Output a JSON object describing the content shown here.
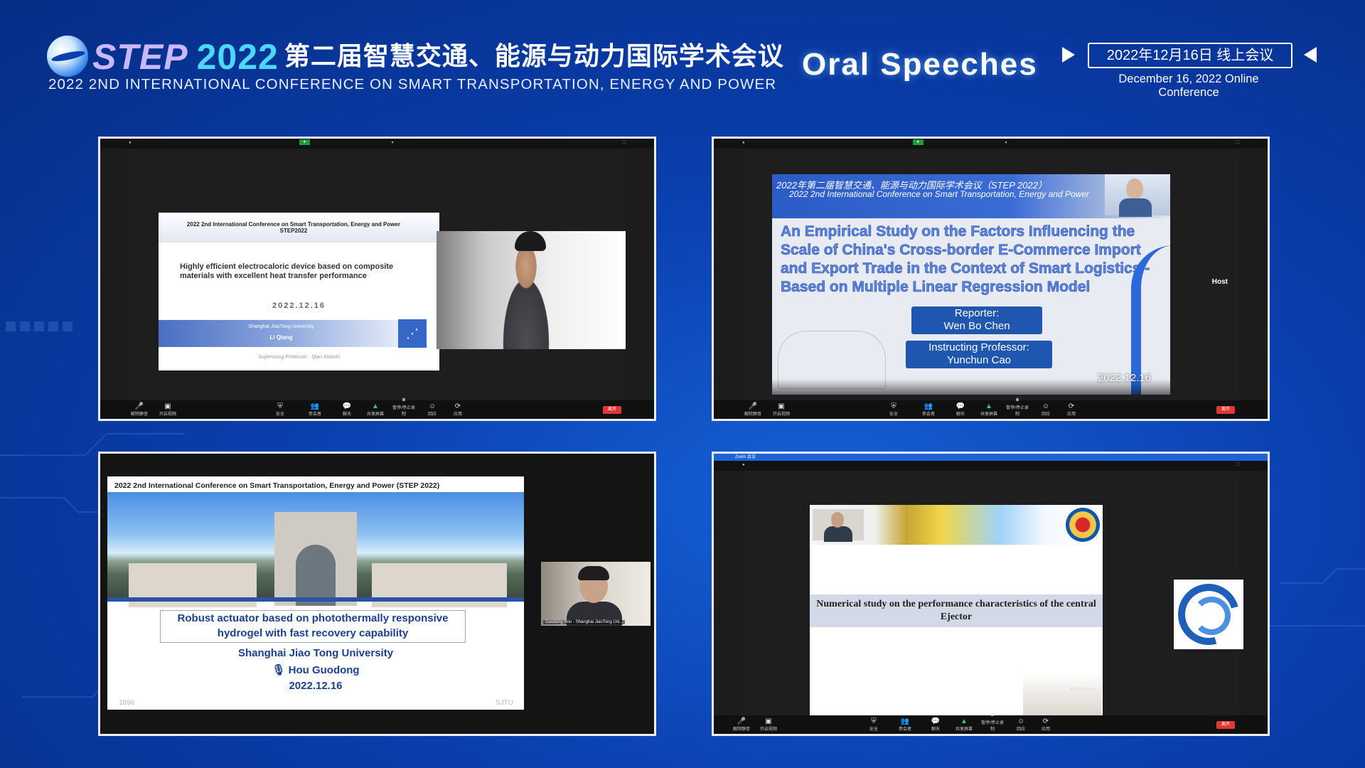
{
  "header": {
    "brand_step": "STEP",
    "brand_year": "2022",
    "conf_cn": "第二届智慧交通、能源与动力国际学术会议",
    "conf_en": "2022 2ND INTERNATIONAL CONFERENCE ON SMART TRANSPORTATION, ENERGY AND POWER",
    "section": "Oral Speeches",
    "date_cn": "2022年12月16日  线上会议",
    "date_en": "December 16, 2022  Online Conference"
  },
  "colors": {
    "background": "#0a3fae",
    "accent": "#4ad8ff",
    "record_green": "#1d9b3a",
    "end_red": "#e23636"
  },
  "toolbar": {
    "items": [
      "解除静音",
      "开启视频",
      "安全",
      "参会者",
      "聊天",
      "共享屏幕",
      "暂停/停止录制",
      "回应",
      "应用"
    ],
    "end": "离开"
  },
  "windows": [
    {
      "slide": {
        "header": "2022 2nd International Conference on Smart Transportation, Energy and Power STEP2022",
        "title": "Highly efficient electrocaloric device based on composite materials with excellent heat transfer performance",
        "date": "2022.12.16",
        "university": "Shanghai JiaoTong University",
        "speaker": "Li Qiang",
        "supervisor": "Supervising Professor：Qian Xiaoshi"
      }
    },
    {
      "slide": {
        "header_cn": "2022年第二届智慧交通、能源与动力国际学术会议（STEP 2022）",
        "header_en": "2022 2nd International Conference on Smart Transportation, Energy and Power",
        "title": "An Empirical Study on the Factors Influencing the Scale of China's Cross-border E-Commerce Import and Export Trade in the Context of Smart Logistics - Based on Multiple Linear Regression Model",
        "reporter_label": "Reporter:",
        "reporter": "Wen Bo Chen",
        "professor_label": "Instructing Professor:",
        "professor": "Yunchun Cao",
        "date": "2022.12.16"
      },
      "host_label": "Host"
    },
    {
      "slide": {
        "header": "2022 2nd International Conference on Smart Transportation, Energy and Power (STEP 2022)",
        "title": "Robust actuator based on photothermally responsive hydrogel with fast recovery capability",
        "university": "Shanghai Jiao Tong University",
        "speaker": "Hou Guodong",
        "date": "2022.12.16",
        "year_left": "1896",
        "year_right": "SJTU"
      },
      "cam_label": "Guodong Hou - Shanghai JiaoTong Uni..."
    },
    {
      "zoom_title": "Zoom 会议",
      "slide": {
        "title": "Numerical study on the performance characteristics of the central Ejector"
      },
      "watermark": "激活 Windows"
    }
  ]
}
